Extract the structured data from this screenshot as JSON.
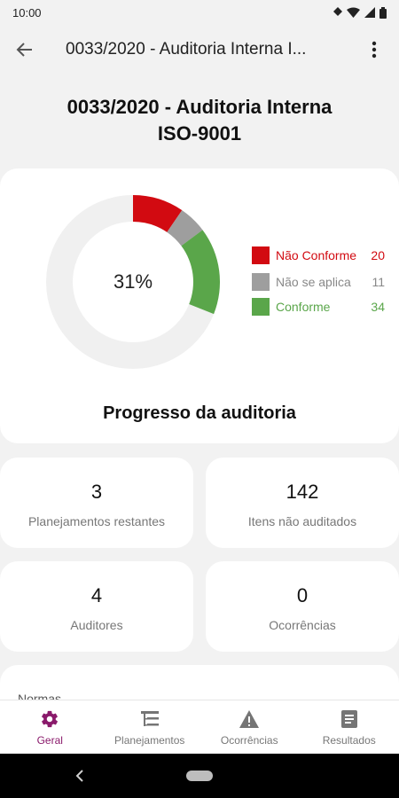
{
  "status_bar": {
    "time": "10:00"
  },
  "app_bar": {
    "title": "0033/2020 - Auditoria Interna I..."
  },
  "page_title_line1": "0033/2020 - Auditoria Interna",
  "page_title_line2": "ISO-9001",
  "progress": {
    "percent_label": "31%",
    "label": "Progresso da auditoria",
    "legend": [
      {
        "label": "Não Conforme",
        "value": "20",
        "color": "#d20a11"
      },
      {
        "label": "Não se aplica",
        "value": "11",
        "color": "#9e9e9e"
      },
      {
        "label": "Conforme",
        "value": "34",
        "color": "#5aa64a"
      }
    ],
    "ring_track_color": "#f0f0f0"
  },
  "stats": [
    {
      "value": "3",
      "label": "Planejamentos restantes"
    },
    {
      "value": "142",
      "label": "Itens não auditados"
    },
    {
      "value": "4",
      "label": "Auditores"
    },
    {
      "value": "0",
      "label": "Ocorrências"
    }
  ],
  "partial_section": {
    "label": "Normas"
  },
  "bottom_nav": [
    {
      "label": "Geral",
      "icon": "gear-icon",
      "active": true
    },
    {
      "label": "Planejamentos",
      "icon": "list-tree-icon",
      "active": false
    },
    {
      "label": "Ocorrências",
      "icon": "warning-icon",
      "active": false
    },
    {
      "label": "Resultados",
      "icon": "report-icon",
      "active": false
    }
  ],
  "colors": {
    "accent": "#8a1a6b",
    "inactive": "#777777"
  }
}
